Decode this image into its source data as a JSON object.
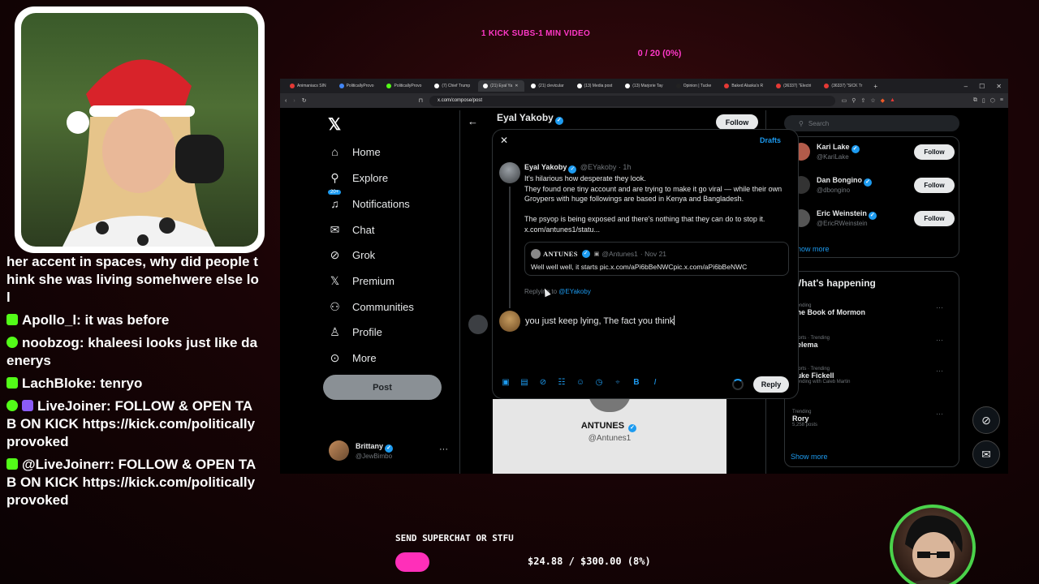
{
  "overlay": {
    "goal_label": "1 KICK SUBS-1 MIN VIDEO",
    "goal_progress": "0 / 20 (0%)",
    "superchat_label": "SEND SUPERCHAT OR STFU",
    "superchat_amount": "$24.88 / $300.00 (8%)",
    "superchat_fraction": 0.08,
    "accent_color": "#ff38c8"
  },
  "chat": [
    {
      "user": "",
      "text": "her accent in spaces, why did people think she was living somehwere else lol",
      "badge_color": "#53fc18"
    },
    {
      "user": "Apollo_l",
      "text": "it was before",
      "badge_color": "#53fc18"
    },
    {
      "user": "noobzog",
      "text": "khaleesi looks just like daenerys",
      "badge_color": "#53fc18"
    },
    {
      "user": "LachBloke",
      "text": "tenryo",
      "badge_color": "#53fc18"
    },
    {
      "user": "LiveJoiner",
      "text": "FOLLOW & OPEN TAB ON KICK https://kick.com/politicallyprovoked",
      "badge_color": "#8b5cf6"
    },
    {
      "user": "@LiveJoinerr",
      "text": "FOLLOW & OPEN TAB ON KICK https://kick.com/politicallyprovoked",
      "badge_color": "#53fc18"
    }
  ],
  "browser": {
    "tabs": [
      {
        "label": "Animaniacs SIN",
        "color": "#e53935"
      },
      {
        "label": "PoliticallyProvo",
        "color": "#4285f4"
      },
      {
        "label": "PoliticallyProvo",
        "color": "#53fc18"
      },
      {
        "label": "(7) Chief Trump",
        "color": "#ffffff"
      },
      {
        "label": "(21) Eyal Ya",
        "color": "#ffffff",
        "active": true
      },
      {
        "label": "(21) clevicular",
        "color": "#ffffff"
      },
      {
        "label": "(13) Media post",
        "color": "#ffffff"
      },
      {
        "label": "(13) Marjorie Tay",
        "color": "#ffffff"
      },
      {
        "label": "Opinion | Tucke",
        "color": "#222222"
      },
      {
        "label": "Baked Alaska's R",
        "color": "#e53935"
      },
      {
        "label": "(36337) \"Electri",
        "color": "#e53935"
      },
      {
        "label": "(36337) \"SICK Tr",
        "color": "#e53935"
      }
    ],
    "url": "x.com/compose/post"
  },
  "x": {
    "nav": [
      {
        "label": "Home",
        "icon": "home-icon",
        "glyph": "⌂"
      },
      {
        "label": "Explore",
        "icon": "search-icon",
        "glyph": "⚲"
      },
      {
        "label": "Notifications",
        "icon": "bell-icon",
        "glyph": "🔔",
        "badge": "20+"
      },
      {
        "label": "Chat",
        "icon": "envelope-icon",
        "glyph": "✉"
      },
      {
        "label": "Grok",
        "icon": "grok-icon",
        "glyph": "⊘"
      },
      {
        "label": "Premium",
        "icon": "x-premium-icon",
        "glyph": "𝕏"
      },
      {
        "label": "Communities",
        "icon": "people-icon",
        "glyph": "👥"
      },
      {
        "label": "Profile",
        "icon": "person-icon",
        "glyph": "♙"
      },
      {
        "label": "More",
        "icon": "more-circle-icon",
        "glyph": "⋯"
      }
    ],
    "post_label": "Post",
    "account": {
      "name": "Brittany",
      "handle": "@JewBimbo"
    },
    "profile_header": {
      "name": "Eyal Yakoby",
      "follow_label": "Follow"
    },
    "search_placeholder": "Search",
    "who_to_follow": [
      {
        "name": "Kari Lake",
        "handle": "@KariLake",
        "button": "Follow",
        "color": "#b25b4a"
      },
      {
        "name": "Dan Bongino",
        "handle": "@dbongino",
        "button": "Follow",
        "color": "#333333"
      },
      {
        "name": "Eric Weinstein",
        "handle": "@EricRWeinstein",
        "button": "Follow",
        "color": "#555555"
      }
    ],
    "show_more_1": "Show more",
    "trends_title": "What's happening",
    "trends": [
      {
        "context": "Trending",
        "title": "The Book of Mormon",
        "sub": ""
      },
      {
        "context": "Sports · Trending",
        "title": "Selema",
        "sub": ""
      },
      {
        "context": "Sports · Trending",
        "title": "Luke Fickell",
        "sub": "Trending with Caleb Martin"
      },
      {
        "context": "Trending",
        "title": "Rory",
        "sub": "5,258 posts"
      }
    ],
    "show_more_2": "Show more",
    "quoted_card": {
      "name": "ANTUNES",
      "handle": "@Antunes1"
    }
  },
  "modal": {
    "drafts_label": "Drafts",
    "tweet": {
      "name": "Eyal Yakoby",
      "handle": "@EYakoby",
      "time": "· 1h",
      "paragraph1": "It's hilarious how desperate they look.",
      "paragraph2": "They found one tiny account and are trying to make it go viral — while their own Groypers with huge followings are based in Kenya and Bangladesh.",
      "paragraph3": "The psyop is being exposed and there's nothing that they can do to stop it.",
      "link": "x.com/antunes1/statu..."
    },
    "quote": {
      "name": "ANTUNES",
      "handle": "@Antunes1",
      "time": "· Nov 21",
      "text": "Well well well, it starts pic.x.com/aPi6bBeNWCpic.x.com/aPi6bBeNWC"
    },
    "replying_prefix": "Replying to",
    "replying_handle": "@EYakoby",
    "reply_text": "you just keep lying, The fact you think",
    "reply_button": "Reply"
  }
}
